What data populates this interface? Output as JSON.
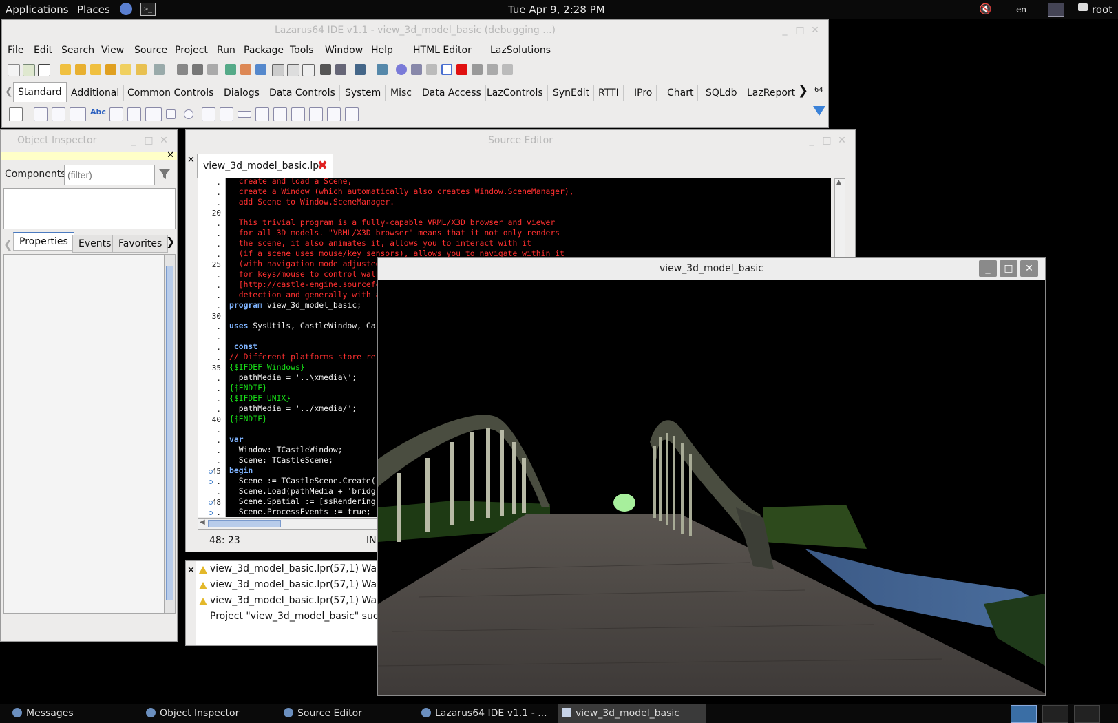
{
  "top_panel": {
    "applications": "Applications",
    "places": "Places",
    "datetime": "Tue Apr  9,  2:28 PM",
    "lang": "en",
    "user": "root"
  },
  "ide": {
    "title": "Lazarus64 IDE v1.1 - view_3d_model_basic (debugging ...)",
    "menu": [
      "File",
      "Edit",
      "Search",
      "View",
      "Source",
      "Project",
      "Run",
      "Package",
      "Tools",
      "Window",
      "Help",
      "HTML Editor",
      "LazSolutions"
    ],
    "palette_tabs": [
      "Standard",
      "Additional",
      "Common Controls",
      "Dialogs",
      "Data Controls",
      "System",
      "Misc",
      "Data Access",
      "LazControls",
      "SynEdit",
      "RTTI",
      "IPro",
      "Chart",
      "SQLdb",
      "LazReport"
    ],
    "badge": "64"
  },
  "object_inspector": {
    "title": "Object Inspector",
    "components_label": "Components",
    "filter_placeholder": "(filter)",
    "tabs": [
      "Properties",
      "Events",
      "Favorites"
    ]
  },
  "source_editor": {
    "title": "Source Editor",
    "tab_label": "view_3d_model_basic.lpr",
    "status_pos": "48: 23",
    "status_mode": "IN",
    "lines": [
      {
        "n": ".",
        "t": "  create and load a Scene,",
        "c": "c-red"
      },
      {
        "n": ".",
        "t": "  create a Window (which automatically also creates Window.SceneManager),",
        "c": "c-red"
      },
      {
        "n": ".",
        "t": "  add Scene to Window.SceneManager.",
        "c": "c-red"
      },
      {
        "n": "20",
        "t": "",
        "c": "c-red"
      },
      {
        "n": ".",
        "t": "  This trivial program is a fully-capable VRML/X3D browser and viewer",
        "c": "c-red"
      },
      {
        "n": ".",
        "t": "  for all 3D models. \"VRML/X3D browser\" means that it not only renders",
        "c": "c-red"
      },
      {
        "n": ".",
        "t": "  the scene, it also animates it, allows you to interact with it",
        "c": "c-red"
      },
      {
        "n": ".",
        "t": "  (if a scene uses mouse/key sensors), allows you to navigate within it",
        "c": "c-red"
      },
      {
        "n": "25",
        "t": "  (with navigation mode adjusted",
        "c": "c-red"
      },
      {
        "n": ".",
        "t": "  for keys/mouse to control walk",
        "c": "c-red"
      },
      {
        "n": ".",
        "t": "  [http://castle-engine.sourcefo",
        "c": "c-red"
      },
      {
        "n": ".",
        "t": "  detection and generally with a",
        "c": "c-red"
      },
      {
        "n": ".",
        "t": "program view_3d_model_basic;",
        "c": "c-tx",
        "kw": "program"
      },
      {
        "n": "30",
        "t": "",
        "c": "c-tx"
      },
      {
        "n": ".",
        "t": "uses SysUtils, CastleWindow, Ca",
        "c": "c-tx",
        "kw": "uses"
      },
      {
        "n": ".",
        "t": "",
        "c": "c-tx"
      },
      {
        "n": ".",
        "t": " const",
        "c": "c-kw"
      },
      {
        "n": ".",
        "t": "// Different platforms store re",
        "c": "c-red"
      },
      {
        "n": "35",
        "t": "{$IFDEF Windows}",
        "c": "c-grn"
      },
      {
        "n": ".",
        "t": "  pathMedia = '..\\xmedia\\';",
        "c": "c-tx"
      },
      {
        "n": ".",
        "t": "{$ENDIF}",
        "c": "c-grn"
      },
      {
        "n": ".",
        "t": "{$IFDEF UNIX}",
        "c": "c-grn"
      },
      {
        "n": ".",
        "t": "  pathMedia = '../xmedia/';",
        "c": "c-tx"
      },
      {
        "n": "40",
        "t": "{$ENDIF}",
        "c": "c-grn"
      },
      {
        "n": ".",
        "t": "",
        "c": "c-tx"
      },
      {
        "n": ".",
        "t": "var",
        "c": "c-kw"
      },
      {
        "n": ".",
        "t": "  Window: TCastleWindow;",
        "c": "c-tx"
      },
      {
        "n": ".",
        "t": "  Scene: TCastleScene;",
        "c": "c-tx"
      },
      {
        "n": "45",
        "t": "begin",
        "c": "c-kw"
      },
      {
        "n": ".",
        "t": "  Scene := TCastleScene.Create(",
        "c": "c-tx"
      },
      {
        "n": ".",
        "t": "  Scene.Load(pathMedia + 'bridg",
        "c": "c-tx"
      },
      {
        "n": "48",
        "t": "  Scene.Spatial := [ssRendering",
        "c": "c-tx"
      },
      {
        "n": ".",
        "t": "  Scene.ProcessEvents := true;",
        "c": "c-tx"
      }
    ]
  },
  "messages": {
    "items": [
      "view_3d_model_basic.lpr(57,1) Warn",
      "view_3d_model_basic.lpr(57,1) Warn",
      "view_3d_model_basic.lpr(57,1) Warn"
    ],
    "status": "Project \"view_3d_model_basic\" succe"
  },
  "view3d": {
    "title": "view_3d_model_basic"
  },
  "taskbar": [
    {
      "label": "Messages",
      "active": false
    },
    {
      "label": "Object Inspector",
      "active": false
    },
    {
      "label": "Source Editor",
      "active": false
    },
    {
      "label": "Lazarus64 IDE v1.1 - ...",
      "active": false
    },
    {
      "label": "view_3d_model_basic",
      "active": true
    }
  ],
  "colors": {
    "comment": "#ff3030",
    "keyword": "#7fb4ff",
    "directive": "#18e018",
    "tab_accent": "#4a7ac0"
  }
}
